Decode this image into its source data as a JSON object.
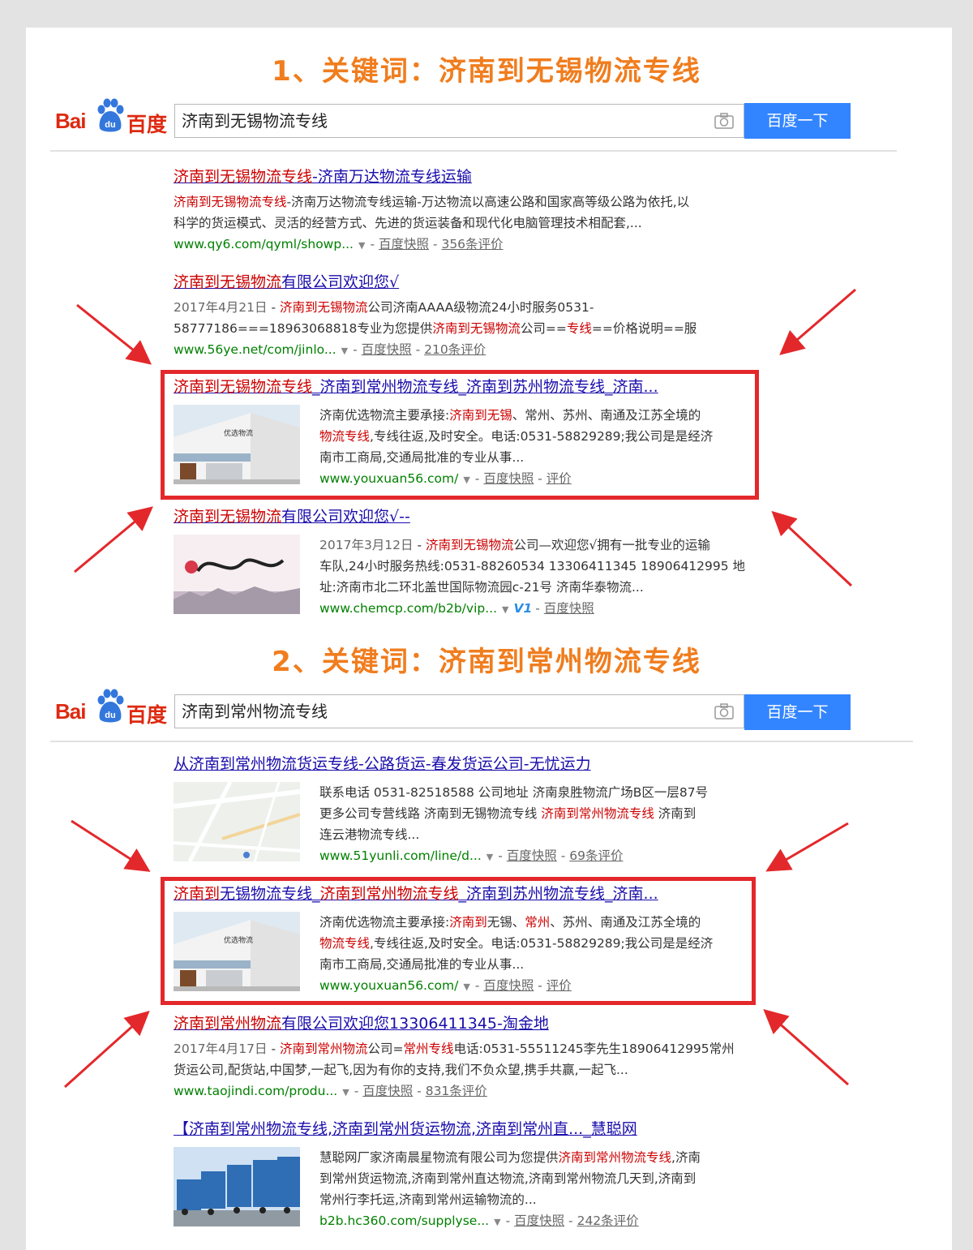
{
  "sections": [
    {
      "heading": "1、关键词：济南到无锡物流专线",
      "search_query": "济南到无锡物流专线",
      "button_label": "百度一下",
      "results": [
        {
          "title": [
            {
              "t": "济南到无锡物流专线",
              "em": true
            },
            {
              "t": "-济南万达物流专线运输",
              "em": false
            }
          ],
          "abstract": [
            [
              {
                "t": "济南到无锡物流专线",
                "em": true
              },
              {
                "t": "-济南万达物流专线运输-万达物流以高速公路和国家高等级公路为依托,以",
                "em": false
              }
            ],
            [
              {
                "t": "科学的货运模式、灵活的经营方式、先进的货运装备和现代化电脑管理技术相配套,...",
                "em": false
              }
            ]
          ],
          "url": "www.qy6.com/qyml/showp...",
          "snapshot": "百度快照",
          "reviews": "356条评价"
        },
        {
          "title": [
            {
              "t": "济南到无锡物流",
              "em": true
            },
            {
              "t": "有限公司欢迎您√",
              "em": false
            }
          ],
          "date": "2017年4月21日",
          "abstract": [
            [
              {
                "t": "济南到无锡物流",
                "em": true
              },
              {
                "t": "公司济南AAAA级物流24小时服务0531-",
                "em": false
              }
            ],
            [
              {
                "t": "58777186===18963068818专业为您提供",
                "em": false
              },
              {
                "t": "济南到无锡物流",
                "em": true
              },
              {
                "t": "公司==",
                "em": false
              },
              {
                "t": "专线",
                "em": true
              },
              {
                "t": "==价格说明==服",
                "em": false
              }
            ]
          ],
          "url": "www.56ye.net/com/jinlo...",
          "snapshot": "百度快照",
          "reviews": "210条评价"
        },
        {
          "title": [
            {
              "t": "济南到无锡物流专线",
              "em": true
            },
            {
              "t": "_济南到常州物流专线_济南到苏州物流专线_济南...",
              "em": false
            }
          ],
          "abstract": [
            [
              {
                "t": "济南优选物流主要承接:",
                "em": false
              },
              {
                "t": "济南到无锡",
                "em": true
              },
              {
                "t": "、常州、苏州、南通及江苏全境的",
                "em": false
              }
            ],
            [
              {
                "t": "物流专线",
                "em": true
              },
              {
                "t": ",专线往返,及时安全。电话:0531-58829289;我公司是是经济",
                "em": false
              }
            ],
            [
              {
                "t": "南市工商局,交通局批准的专业从事...",
                "em": false
              }
            ]
          ],
          "thumb_text": "优选物流",
          "url": "www.youxuan56.com/",
          "snapshot": "百度快照",
          "reviews": "评价"
        },
        {
          "title": [
            {
              "t": "济南到无锡物流",
              "em": true
            },
            {
              "t": "有限公司欢迎您√--",
              "em": false
            }
          ],
          "date": "2017年3月12日",
          "abstract": [
            [
              {
                "t": "济南到无锡物流",
                "em": true
              },
              {
                "t": "公司—欢迎您√拥有一批专业的运输",
                "em": false
              }
            ],
            [
              {
                "t": "车队,24小时服务热线:0531-88260534 13306411345 18906412995 地",
                "em": false
              }
            ],
            [
              {
                "t": "址:济南市北二环北盖世国际物流园c-21号 济南华泰物流...",
                "em": false
              }
            ]
          ],
          "url": "www.chemcp.com/b2b/vip...",
          "badge": "V1",
          "snapshot": "百度快照"
        }
      ]
    },
    {
      "heading": "2、关键词：济南到常州物流专线",
      "search_query": "济南到常州物流专线",
      "button_label": "百度一下",
      "results": [
        {
          "title": [
            {
              "t": "从济南到常州物流货运专线-公路货运-春发货运公司-无忧运力",
              "em": false
            }
          ],
          "abstract": [
            [
              {
                "t": "联系电话 0531-82518588 公司地址 济南泉胜物流广场B区一层87号",
                "em": false
              }
            ],
            [
              {
                "t": "更多公司专营线路 济南到无锡物流专线 ",
                "em": false
              },
              {
                "t": "济南到常州物流专线",
                "em": true
              },
              {
                "t": " 济南到",
                "em": false
              }
            ],
            [
              {
                "t": "连云港物流专线...",
                "em": false
              }
            ]
          ],
          "url": "www.51yunli.com/line/d...",
          "snapshot": "百度快照",
          "reviews": "69条评价"
        },
        {
          "title": [
            {
              "t": "济南到",
              "em": true
            },
            {
              "t": "无锡物流专线_",
              "em": false
            },
            {
              "t": "济南到常州物流专线",
              "em": true
            },
            {
              "t": "_济南到苏州物流专线_济南...",
              "em": false
            }
          ],
          "abstract": [
            [
              {
                "t": "济南优选物流主要承接:",
                "em": false
              },
              {
                "t": "济南到",
                "em": true
              },
              {
                "t": "无锡、",
                "em": false
              },
              {
                "t": "常州",
                "em": true
              },
              {
                "t": "、苏州、南通及江苏全境的",
                "em": false
              }
            ],
            [
              {
                "t": "物流专线",
                "em": true
              },
              {
                "t": ",专线往返,及时安全。电话:0531-58829289;我公司是是经济",
                "em": false
              }
            ],
            [
              {
                "t": "南市工商局,交通局批准的专业从事...",
                "em": false
              }
            ]
          ],
          "thumb_text": "优选物流",
          "url": "www.youxuan56.com/",
          "snapshot": "百度快照",
          "reviews": "评价"
        },
        {
          "title": [
            {
              "t": "济南到常州物流",
              "em": true
            },
            {
              "t": "有限公司欢迎您13306411345-淘金地",
              "em": false
            }
          ],
          "date": "2017年4月17日",
          "abstract": [
            [
              {
                "t": "济南到常州物流",
                "em": true
              },
              {
                "t": "公司=",
                "em": false
              },
              {
                "t": "常州专线",
                "em": true
              },
              {
                "t": "电话:0531-55511245李先生18906412995常州",
                "em": false
              }
            ],
            [
              {
                "t": "货运公司,配货站,中国梦,一起飞,因为有你的支持,我们不负众望,携手共赢,一起飞...",
                "em": false
              }
            ]
          ],
          "url": "www.taojindi.com/produ...",
          "snapshot": "百度快照",
          "reviews": "831条评价"
        },
        {
          "title": [
            {
              "t": "【济南到常州物流专线,济南到常州货运物流,济南到常州直..._慧聪网",
              "em": false
            }
          ],
          "abstract": [
            [
              {
                "t": "慧聪网厂家济南晨星物流有限公司为您提供",
                "em": false
              },
              {
                "t": "济南到常州物流专线",
                "em": true
              },
              {
                "t": ",济南",
                "em": false
              }
            ],
            [
              {
                "t": "到常州货运物流,济南到常州直达物流,济南到常州物流几天到,济南到",
                "em": false
              }
            ],
            [
              {
                "t": "常州行李托运,济南到常州运输物流的...",
                "em": false
              }
            ]
          ],
          "url": "b2b.hc360.com/supplyse...",
          "snapshot": "百度快照",
          "reviews": "242条评价"
        }
      ]
    }
  ],
  "logo": {
    "latin": "Bai",
    "paw": "du",
    "cjk": "百度"
  },
  "colors": {
    "heading": "#f07d1e",
    "link": "#1a0dab",
    "highlight": "#c00000",
    "url": "#008000",
    "button": "#3385ff",
    "frame": "#e3282b"
  }
}
